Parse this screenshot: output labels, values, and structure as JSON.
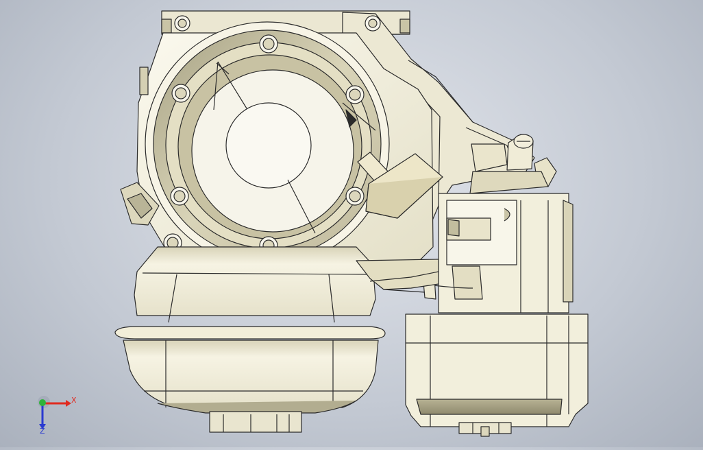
{
  "viewport": {
    "background_top": "#e3e6ec",
    "background_bottom": "#aab1bd"
  },
  "model": {
    "part_fill": "#f2efdf",
    "part_shade": "#c9c4a6",
    "part_dark": "#8f8a6e",
    "edge_color": "#2b2b2b"
  },
  "triad": {
    "x_label": "X",
    "z_label": "Z",
    "x_color": "#e02a1f",
    "y_color": "#2fb33a",
    "z_color": "#2a3ad0"
  }
}
